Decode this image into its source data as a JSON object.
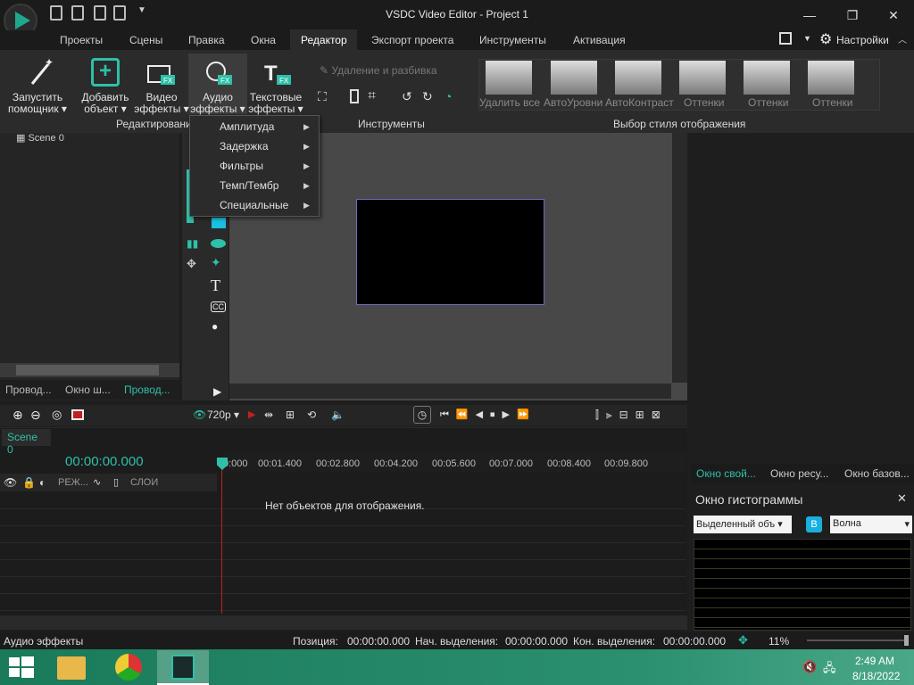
{
  "window": {
    "title": "VSDC Video Editor - Project 1",
    "settings_label": "Настройки"
  },
  "menu": {
    "items": [
      "Проекты",
      "Сцены",
      "Правка",
      "Окна",
      "Редактор",
      "Экспорт проекта",
      "Инструменты",
      "Активация"
    ],
    "active": "Редактор"
  },
  "ribbon": {
    "wizard": {
      "line1": "Запустить",
      "line2": "помощник"
    },
    "add_object": {
      "line1": "Добавить",
      "line2": "объект"
    },
    "video_fx": {
      "line1": "Видео",
      "line2": "эффекты"
    },
    "audio_fx": {
      "line1": "Аудио",
      "line2": "эффекты"
    },
    "text_fx": {
      "line1": "Текстовые",
      "line2": "эффекты"
    },
    "group_editing": "Редактировани",
    "delete_split": "Удаление и разбивка",
    "group_tools": "Инструменты",
    "style_thumbs": [
      "Удалить все",
      "АвтоУровни",
      "АвтоКонтраст",
      "Оттенки",
      "Оттенки",
      "Оттенки"
    ],
    "group_style": "Выбор стиля отображения"
  },
  "audio_menu": {
    "items": [
      "Амплитуда",
      "Задержка",
      "Фильтры",
      "Темп/Тембр",
      "Специальные"
    ]
  },
  "left_panel": {
    "scene_item": "Scene 0",
    "tabs": [
      "Провод...",
      "Окно ш...",
      "Провод..."
    ]
  },
  "preview": {
    "resolution": "720p"
  },
  "timeline": {
    "scene_tab": "Scene 0",
    "timecode": "00:00:00.000",
    "col_mode": "РЕЖ...",
    "col_layers": "СЛОИ",
    "empty_msg": "Нет объектов для отображения.",
    "ruler": [
      "0:000",
      "00:01.400",
      "00:02.800",
      "00:04.200",
      "00:05.600",
      "00:07.000",
      "00:08.400",
      "00:09.800"
    ]
  },
  "right_panel": {
    "tabs": [
      "Окно свой...",
      "Окно ресу...",
      "Окно базов..."
    ],
    "hist_title": "Окно гистограммы",
    "hist_source": "Выделенный объ",
    "hist_mode": "Волна",
    "hist_btn_b": "B"
  },
  "status": {
    "left": "Аудио эффекты",
    "pos_label": "Позиция:",
    "pos_val": "00:00:00.000",
    "sel_start_label": "Нач. выделения:",
    "sel_start_val": "00:00:00.000",
    "sel_end_label": "Кон. выделения:",
    "sel_end_val": "00:00:00.000",
    "zoom": "11%"
  },
  "taskbar": {
    "time": "2:49 AM",
    "date": "8/18/2022"
  },
  "colors": {
    "accent": "#2ec0a8",
    "timeline_cursor": "#c02020",
    "bg": "#1e1e1e"
  }
}
